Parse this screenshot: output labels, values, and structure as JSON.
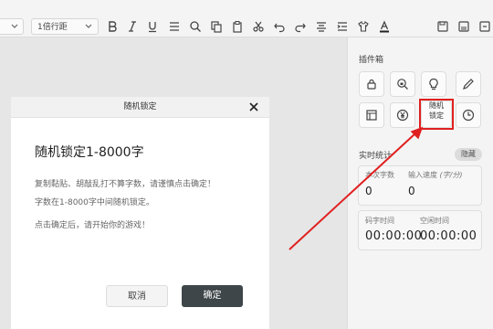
{
  "toolbar": {
    "font_dropdown": "",
    "line_spacing": "1倍行距",
    "icons": [
      "bold-icon",
      "italic-icon",
      "underline-icon",
      "strikethrough-icon",
      "search-icon",
      "copy-icon",
      "cut-icon",
      "undo-icon",
      "redo-icon",
      "align-icon",
      "indent-icon",
      "shirt-icon",
      "font-color-icon",
      "save-icon",
      "save-as-icon",
      "more-icon"
    ]
  },
  "modal": {
    "title": "随机锁定",
    "heading": "随机锁定1-8000字",
    "line1": "复制黏贴、胡敲乱打不算字数，请谨慎点击确定！",
    "line2": "字数在1-8000字中间随机锁定。",
    "line3": "点击确定后，请开始你的游戏！",
    "cancel": "取消",
    "confirm": "确定"
  },
  "sidebar": {
    "plugin_title": "插件箱",
    "plugins": [
      "lock-icon",
      "search-lock-icon",
      "lightbulb-icon",
      "pen-icon",
      "layout-icon",
      "yen-icon",
      "random-lock",
      "clock-icon"
    ],
    "random_lock_line1": "随机",
    "random_lock_line2": "锁定",
    "stats_title": "实时统计",
    "hide": "隐藏",
    "word_count_label": "本次字数",
    "word_count": "0",
    "speed_label_a": "输入速度",
    "speed_label_b": "(字/分)",
    "speed": "0",
    "typing_time_label": "码字时间",
    "typing_time": "00:00:00",
    "idle_time_label": "空闲时间",
    "idle_time": "00:00:00"
  },
  "colors": {
    "highlight": "#e02020",
    "confirm_bg": "#3f4649"
  }
}
